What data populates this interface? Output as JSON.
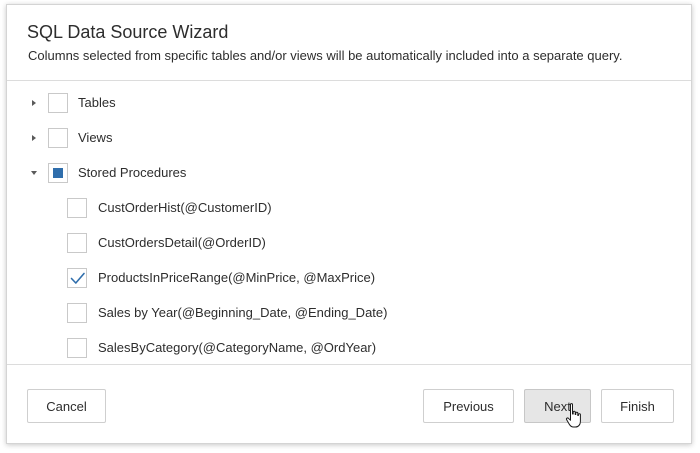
{
  "dialog": {
    "title": "SQL Data Source Wizard",
    "subtitle": "Columns selected from specific tables and/or views will be automatically included into a separate query."
  },
  "tree": {
    "nodes": [
      {
        "label": "Tables",
        "expanded": false,
        "checked": "unchecked"
      },
      {
        "label": "Views",
        "expanded": false,
        "checked": "unchecked"
      },
      {
        "label": "Stored Procedures",
        "expanded": true,
        "checked": "indeterminate",
        "children": [
          {
            "label": "CustOrderHist(@CustomerID)",
            "checked": false
          },
          {
            "label": "CustOrdersDetail(@OrderID)",
            "checked": false
          },
          {
            "label": "ProductsInPriceRange(@MinPrice, @MaxPrice)",
            "checked": true
          },
          {
            "label": "Sales by Year(@Beginning_Date, @Ending_Date)",
            "checked": false
          },
          {
            "label": "SalesByCategory(@CategoryName, @OrdYear)",
            "checked": false
          }
        ]
      }
    ]
  },
  "footer": {
    "cancel_label": "Cancel",
    "previous_label": "Previous",
    "next_label": "Next",
    "finish_label": "Finish"
  },
  "icons": {
    "collapsed": "triangle-right-icon",
    "expanded": "triangle-down-icon",
    "check": "checkmark-icon",
    "cursor": "hand-pointer-icon"
  },
  "colors": {
    "accent": "#2f6eac",
    "border": "#c9c9c9",
    "text": "#2d2d2d",
    "hover_button": "#e6e6e6"
  }
}
